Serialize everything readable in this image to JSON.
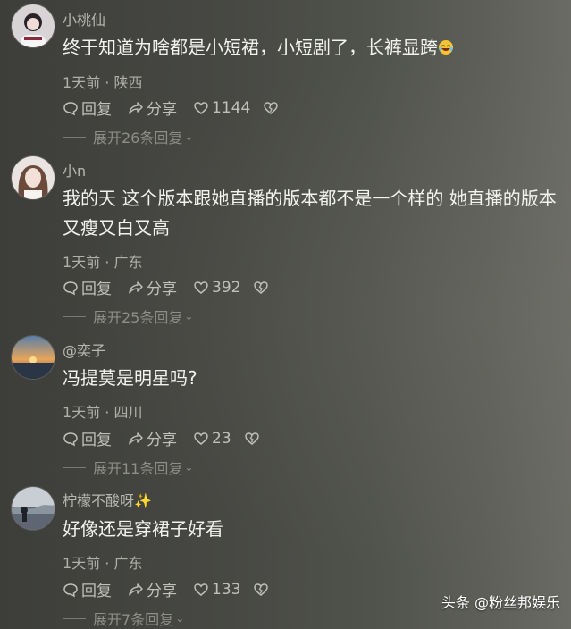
{
  "comments": [
    {
      "username": "小桃仙",
      "content": "终于知道为啥都是小短裙，小短剧了，长裤显跨",
      "meta": "1天前 · 陕西",
      "reply_label": "回复",
      "share_label": "分享",
      "like_count": "1144",
      "expand_label": "展开26条回复"
    },
    {
      "username": "小n",
      "content": "我的天 这个版本跟她直播的版本都不是一个样的 她直播的版本又瘦又白又高",
      "meta": "1天前 · 广东",
      "reply_label": "回复",
      "share_label": "分享",
      "like_count": "392",
      "expand_label": "展开25条回复"
    },
    {
      "username": "@奕子",
      "content": "冯提莫是明星吗?",
      "meta": "1天前 · 四川",
      "reply_label": "回复",
      "share_label": "分享",
      "like_count": "23",
      "expand_label": "展开11条回复"
    },
    {
      "username": "柠檬不酸呀✨",
      "content": "好像还是穿裙子好看",
      "meta": "1天前 · 广东",
      "reply_label": "回复",
      "share_label": "分享",
      "like_count": "133",
      "expand_label": "展开7条回复"
    }
  ],
  "watermark": "头条 @粉丝邦娱乐"
}
